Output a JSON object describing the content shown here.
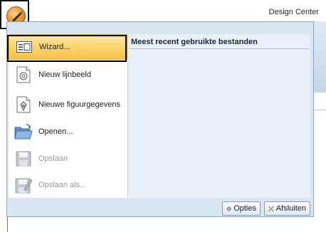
{
  "window": {
    "title": "Design Center"
  },
  "menu": {
    "items": [
      {
        "label": "Wizard...",
        "icon": "wizard-icon",
        "state": "selected"
      },
      {
        "label": "Nieuw lijnbeeld",
        "icon": "new-line-image-icon",
        "state": "enabled"
      },
      {
        "label": "Nieuwe figuurgegevens",
        "icon": "new-figure-data-icon",
        "state": "enabled"
      },
      {
        "label": "Openen...",
        "icon": "open-folder-icon",
        "state": "enabled"
      },
      {
        "label": "Opslaan",
        "icon": "save-icon",
        "state": "disabled"
      },
      {
        "label": "Opslaan als...",
        "icon": "save-as-icon",
        "state": "disabled"
      }
    ],
    "recent": {
      "title": "Meest recent gebruikte bestanden",
      "files": []
    },
    "buttons": {
      "options": "Opties",
      "exit": "Afsluiten"
    }
  },
  "colors": {
    "accent": "#f7c34a",
    "menu_bg": "#dbe6f3",
    "app_button": "#f59a2e"
  }
}
